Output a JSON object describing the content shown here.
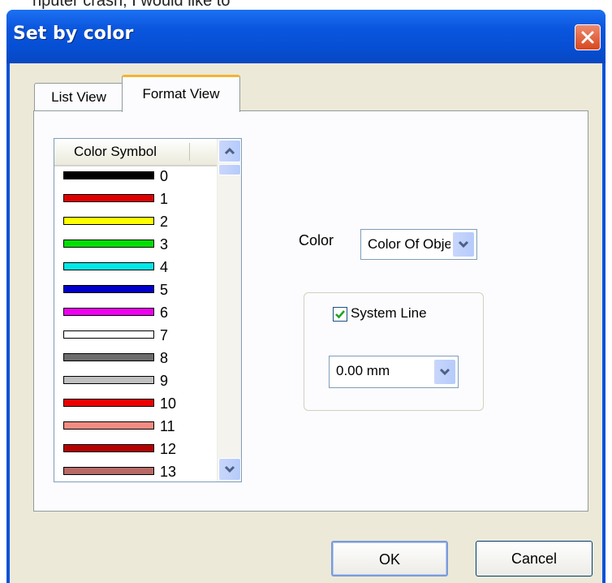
{
  "window": {
    "title": "Set by color"
  },
  "tabs": [
    {
      "label": "List View",
      "active": false
    },
    {
      "label": "Format View",
      "active": true
    }
  ],
  "color_list": {
    "header": "Color Symbol",
    "items": [
      {
        "label": "0",
        "color": "#000000"
      },
      {
        "label": "1",
        "color": "#e00000"
      },
      {
        "label": "2",
        "color": "#ffff00"
      },
      {
        "label": "3",
        "color": "#00e000"
      },
      {
        "label": "4",
        "color": "#00e8e8"
      },
      {
        "label": "5",
        "color": "#0000c8"
      },
      {
        "label": "6",
        "color": "#f000f0"
      },
      {
        "label": "7",
        "color": "#ffffff"
      },
      {
        "label": "8",
        "color": "#6c6c6c"
      },
      {
        "label": "9",
        "color": "#c0c0c0"
      },
      {
        "label": "10",
        "color": "#ec0000"
      },
      {
        "label": "11",
        "color": "#f28c82"
      },
      {
        "label": "12",
        "color": "#b40000"
      },
      {
        "label": "13",
        "color": "#b86a66"
      }
    ]
  },
  "format": {
    "color_label": "Color",
    "color_value": "Color Of Object",
    "system_line_label": "System Line",
    "system_line_checked": true,
    "line_width_value": "0.00 mm"
  },
  "buttons": {
    "ok": "OK",
    "cancel": "Cancel"
  },
  "colors": {
    "title_bar": "#0a56de",
    "dialog_face": "#ece9d8",
    "tab_accent": "#f4b333"
  }
}
